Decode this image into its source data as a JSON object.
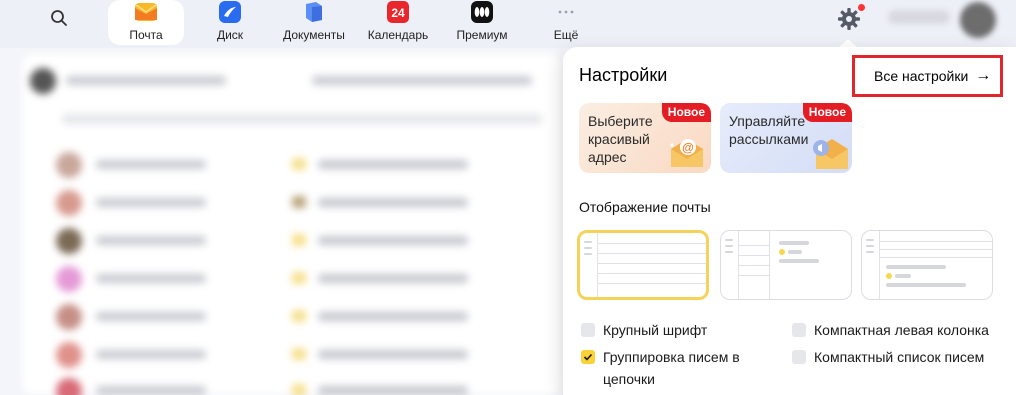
{
  "header": {
    "apps": [
      {
        "label": "Почта",
        "icon": "mail-icon",
        "active": true
      },
      {
        "label": "Диск",
        "icon": "disk-icon",
        "active": false
      },
      {
        "label": "Документы",
        "icon": "documents-icon",
        "active": false
      },
      {
        "label": "Календарь",
        "icon": "calendar-icon",
        "active": false,
        "badge": "24"
      },
      {
        "label": "Премиум",
        "icon": "premium-icon",
        "active": false
      },
      {
        "label": "Ещё",
        "icon": "more-icon",
        "active": false
      }
    ]
  },
  "settings": {
    "title": "Настройки",
    "all_settings_label": "Все настройки",
    "all_settings_arrow": "→",
    "promos": [
      {
        "text": "Выберите красивый адрес",
        "badge": "Новое"
      },
      {
        "text": "Управляйте рассылками",
        "badge": "Новое"
      }
    ],
    "display_title": "Отображение почты",
    "options": [
      {
        "label": "Крупный шрифт",
        "checked": false
      },
      {
        "label": "Компактная левая колонка",
        "checked": false
      },
      {
        "label": "Группировка писем в цепочки",
        "checked": true
      },
      {
        "label": "Компактный список писем",
        "checked": false
      }
    ]
  },
  "colors": {
    "accent_yellow": "#fbd338",
    "badge_red": "#e41c23",
    "highlight_red": "#e0262d"
  }
}
